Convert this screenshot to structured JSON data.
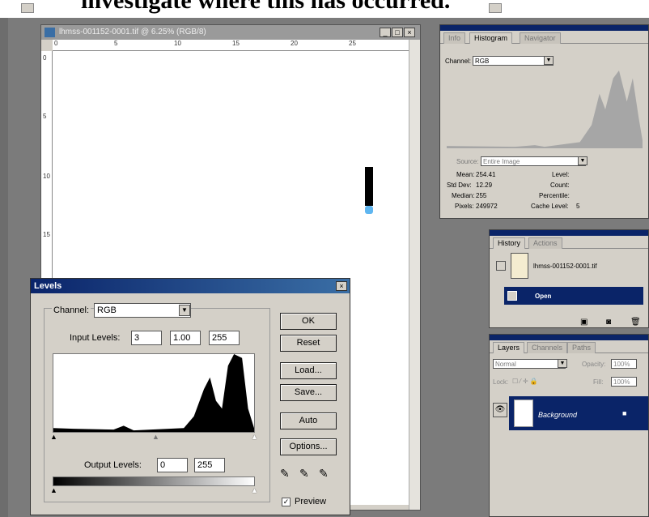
{
  "caption": "investigate where this has occurred.",
  "document": {
    "title": "lhmss-001152-0001.tif @ 6.25% (RGB/8)",
    "win_min": "_",
    "win_max": "□",
    "win_close": "×",
    "ruler_h": [
      "0",
      "5",
      "10",
      "15",
      "20",
      "25"
    ],
    "ruler_v": [
      "0",
      "5",
      "10",
      "15"
    ]
  },
  "info_palette": {
    "tabs": [
      "Info",
      "Histogram",
      "Navigator"
    ],
    "channel_label": "Channel:",
    "channel_value": "RGB",
    "source_label": "Source:",
    "source_value": "Entire Image",
    "stats": {
      "mean_label": "Mean:",
      "mean": "254.41",
      "stddev_label": "Std Dev:",
      "stddev": "12.29",
      "median_label": "Median:",
      "median": "255",
      "pixels_label": "Pixels:",
      "pixels": "249972",
      "level_label": "Level:",
      "count_label": "Count:",
      "percentile_label": "Percentile:",
      "cache_label": "Cache Level:",
      "cache": "5"
    }
  },
  "history_palette": {
    "tabs": [
      "History",
      "Actions"
    ],
    "snapshot_name": "lhmss-001152-0001.tif",
    "step": "Open"
  },
  "layers_palette": {
    "tabs": [
      "Layers",
      "Channels",
      "Paths"
    ],
    "blend_mode": "Normal",
    "opacity_label": "Opacity:",
    "opacity": "100%",
    "lock_label": "Lock:",
    "fill_label": "Fill:",
    "fill": "100%",
    "layer_name": "Background"
  },
  "levels": {
    "title": "Levels",
    "close": "×",
    "channel_label": "Channel:",
    "channel_value": "RGB",
    "input_label": "Input Levels:",
    "input_black": "3",
    "input_gamma": "1.00",
    "input_white": "255",
    "output_label": "Output Levels:",
    "output_black": "0",
    "output_white": "255",
    "buttons": {
      "ok": "OK",
      "reset": "Reset",
      "load": "Load...",
      "save": "Save...",
      "auto": "Auto",
      "options": "Options..."
    },
    "preview_label": "Preview",
    "preview_checked": true
  },
  "colors": {
    "title_blue": "#0a246a",
    "layer_blue": "#0a2468",
    "histogram_gray": "#a6a6a6",
    "dot_blue": "#5fb6f0"
  }
}
